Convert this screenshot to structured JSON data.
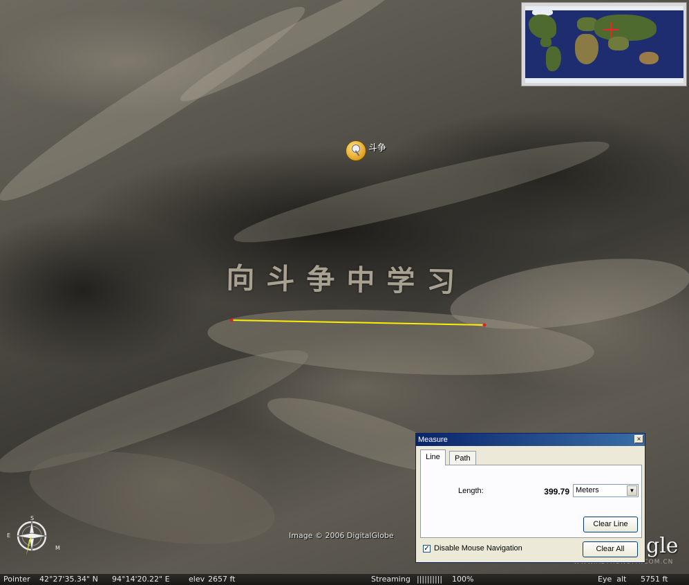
{
  "map": {
    "slogan": "向斗争中学习",
    "placemark_label": "斗争",
    "imagery_credit": "Image © 2006 DigitalGlobe",
    "logo_text": "gle",
    "watermark": "WWW.ASTRONOMY.COM.CN"
  },
  "status_bar": {
    "pointer_label": "Pointer",
    "pointer_lat": "42°27'35.34\" N",
    "pointer_lon": "94°14'20.22\" E",
    "elev_label": "elev",
    "elev_value": "2657 ft",
    "streaming_label": "Streaming",
    "streaming_bars": "||||||||||",
    "streaming_percent": "100%",
    "eye_alt_label": "Eye  alt",
    "eye_alt_value": "5751 ft"
  },
  "measure_dialog": {
    "title": "Measure",
    "close_glyph": "×",
    "tabs": [
      {
        "label": "Line",
        "active": true
      },
      {
        "label": "Path",
        "active": false
      }
    ],
    "length_label": "Length:",
    "length_value": "399.79",
    "units_selected": "Meters",
    "clear_line_label": "Clear Line",
    "clear_all_label": "Clear All",
    "disable_mouse_nav_label": "Disable Mouse Navigation",
    "disable_mouse_nav_checked": true
  },
  "colors": {
    "measure_line": "#ffee00",
    "measure_endpoint": "#dd2222",
    "overview_crosshair": "#ee2222"
  },
  "icons": [
    "placemark-pushpin-icon",
    "compass-icon",
    "overview-crosshair-icon",
    "close-icon",
    "dropdown-arrow-icon",
    "checkmark-icon"
  ]
}
